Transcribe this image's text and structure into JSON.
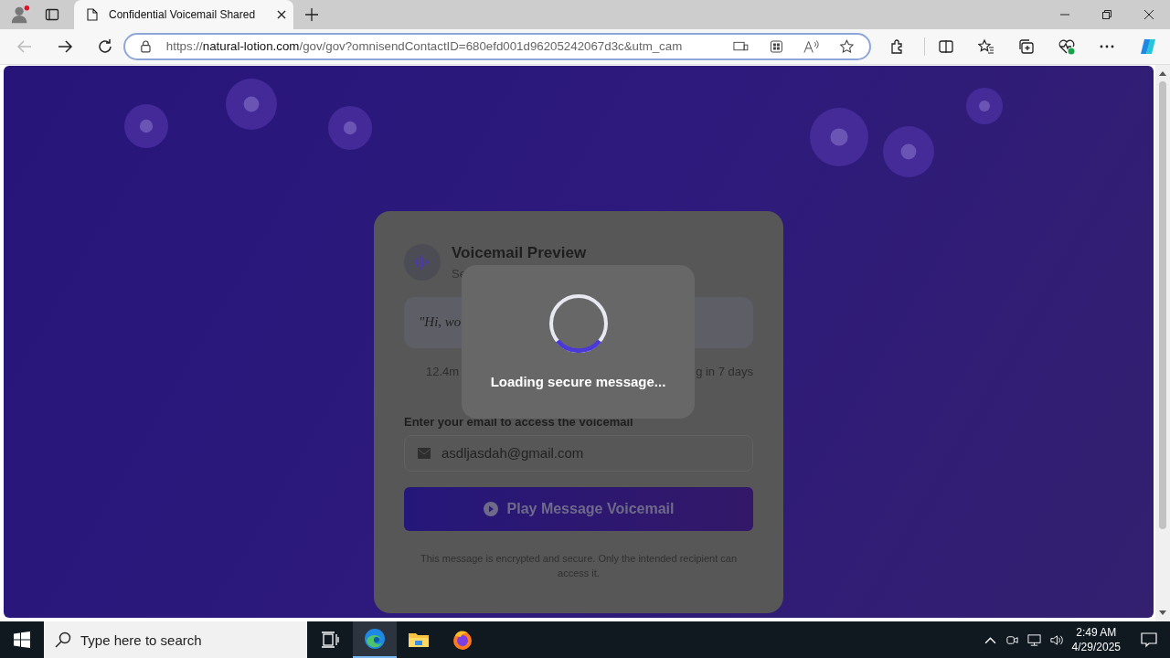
{
  "browser": {
    "tab": {
      "title": "Confidential Voicemail Shared",
      "selected": true
    },
    "address_bar": {
      "url_prefix": "https://",
      "url_domain": "natural-lotion.com",
      "url_rest": "/gov/gov?omnisendContactID=680efd001d96205242067d3c&utm_cam"
    }
  },
  "page": {
    "card": {
      "title": "Voicemail Preview",
      "subtitle": "Se",
      "transcript": "\"Hi, wo",
      "duration": "12.4m",
      "expiry": "g in 7 days",
      "email_label": "Enter your email to access the voicemail",
      "email_value": "asdljasdah@gmail.com",
      "play_button": "Play Message Voicemail",
      "note": "This message is encrypted and secure. Only the intended recipient can access it."
    },
    "loading": {
      "text": "Loading secure message..."
    }
  },
  "taskbar": {
    "search_placeholder": "Type here to search",
    "time": "2:49 AM",
    "date": "4/29/2025"
  }
}
